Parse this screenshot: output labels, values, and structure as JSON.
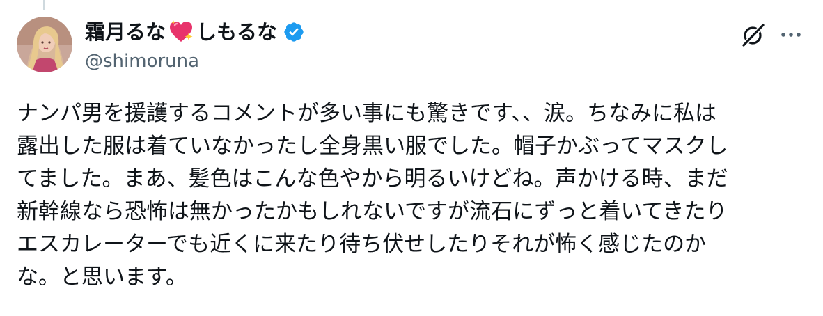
{
  "author": {
    "name_part1": "霜月るな",
    "heart_emoji": "sparkling-heart",
    "name_part2": "しもるな",
    "verified": true,
    "verified_color": "#1d9bf0",
    "handle": "@shimoruna"
  },
  "actions": {
    "grok_icon": "grok-icon",
    "more_icon": "more-horizontal-icon"
  },
  "tweet": {
    "lines": [
      "ナンパ男を援護するコメントが多い事にも驚きです、、涙。ちなみに私は",
      "露出した服は着ていなかったし全身黒い服でした。帽子かぶってマスクし",
      "てました。まあ、髪色はこんな色やから明るいけどね。声かける時、まだ",
      "新幹線なら恐怖は無かったかもしれないですが流石にずっと着いてきたり",
      "エスカレーターでも近くに来たり待ち伏せしたりそれが怖く感じたのか",
      "な。と思います。"
    ]
  },
  "colors": {
    "text": "#0f1419",
    "secondary_text": "#536471",
    "heart": "#e8336b"
  }
}
